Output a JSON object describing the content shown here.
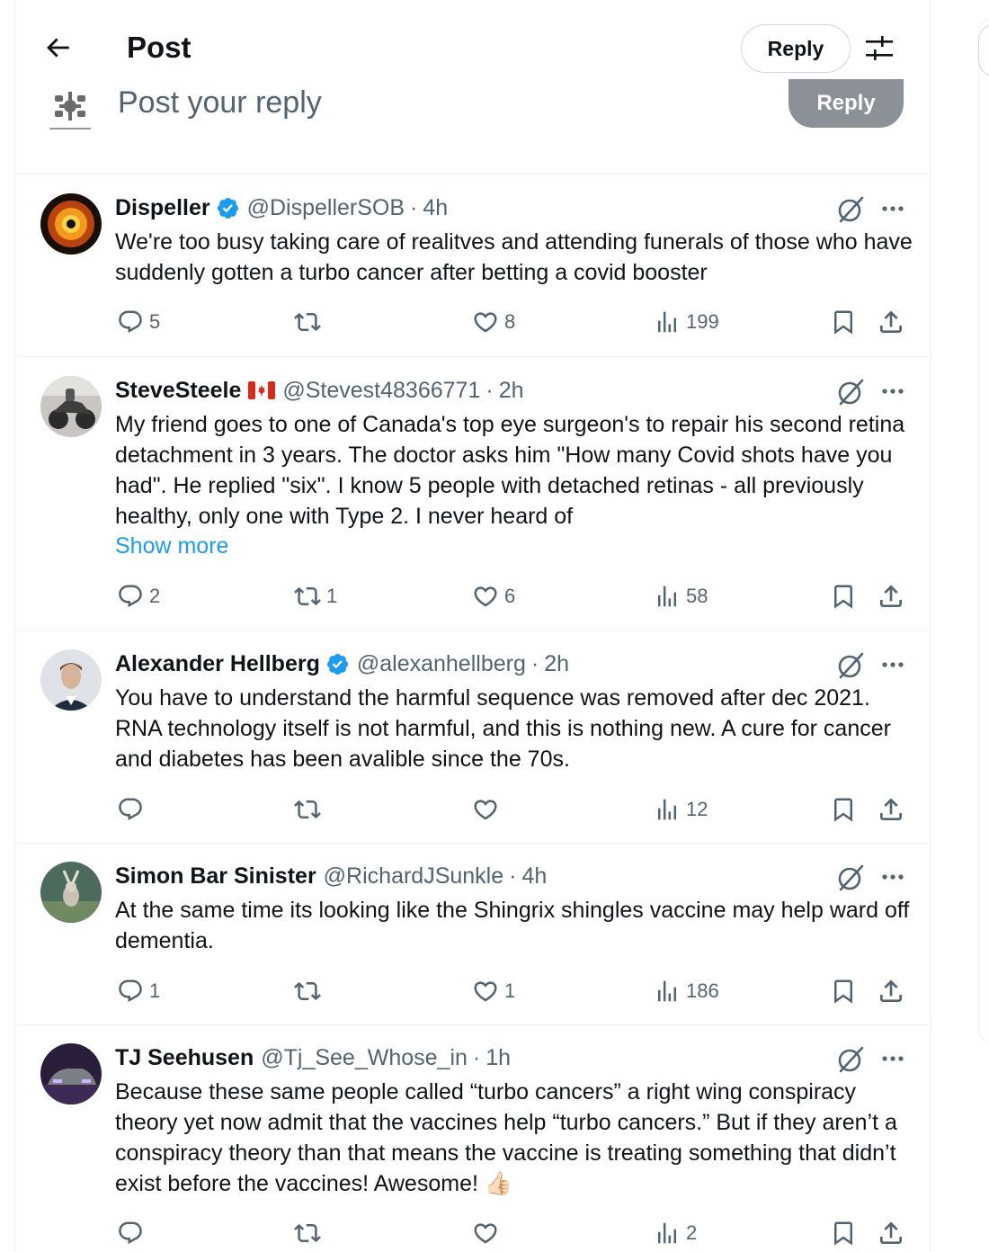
{
  "header": {
    "title": "Post",
    "reply_label": "Reply"
  },
  "composer": {
    "placeholder": "Post your reply",
    "reply_label": "Reply"
  },
  "posts": [
    {
      "name": "Dispeller",
      "verified": true,
      "flag": "",
      "handle": "@DispellerSOB",
      "time": "4h",
      "text": "We're too busy taking care of realitves and attending funerals of those who have suddenly gotten a turbo cancer after betting a covid booster",
      "show_more": "",
      "replies": "5",
      "reposts": "",
      "likes": "8",
      "views": "199"
    },
    {
      "name": "SteveSteele",
      "verified": false,
      "flag": "canada-flag-icon",
      "handle": "@Stevest48366771",
      "time": "2h",
      "text": "My friend goes to one of Canada's top eye surgeon's to repair his second retina detachment in 3 years. The doctor asks him \"How many Covid shots have you had\". He replied \"six\". I know 5 people with detached retinas - all previously healthy, only one with Type 2. I never heard of",
      "show_more": "Show more",
      "replies": "2",
      "reposts": "1",
      "likes": "6",
      "views": "58"
    },
    {
      "name": "Alexander Hellberg",
      "verified": true,
      "flag": "",
      "handle": "@alexanhellberg",
      "time": "2h",
      "text": "You have to understand the harmful sequence was removed after dec 2021. RNA technology itself is not harmful, and this is nothing new. A cure for cancer and diabetes has been avalible since the 70s.",
      "show_more": "",
      "replies": "",
      "reposts": "",
      "likes": "",
      "views": "12"
    },
    {
      "name": "Simon Bar Sinister",
      "verified": false,
      "flag": "",
      "handle": "@RichardJSunkle",
      "time": "4h",
      "text": "At the same time its looking like the Shingrix shingles vaccine may help ward off dementia.",
      "show_more": "",
      "replies": "1",
      "reposts": "",
      "likes": "1",
      "views": "186"
    },
    {
      "name": "TJ Seehusen",
      "verified": false,
      "flag": "",
      "handle": "@Tj_See_Whose_in",
      "time": "1h",
      "text": "Because these same people called “turbo cancers” a right wing conspiracy theory yet now admit that the vaccines help “turbo cancers.” But if they aren’t a conspiracy theory than that means the vaccine is treating something that didn’t exist before the vaccines! Awesome! 👍🏻",
      "show_more": "",
      "replies": "",
      "reposts": "",
      "likes": "",
      "views": "2"
    }
  ],
  "colors": {
    "link": "#1d9bf0",
    "secondary_text": "#536471",
    "verified": "#1d9bf0",
    "reply_disabled": "#8b9196"
  }
}
